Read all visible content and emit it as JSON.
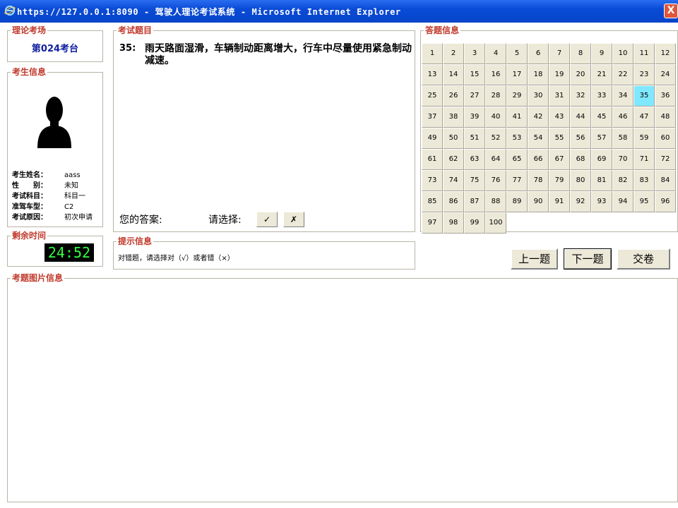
{
  "window": {
    "title": "https://127.0.0.1:8090 - 驾驶人理论考试系统 - Microsoft Internet Explorer",
    "close_label": "X"
  },
  "exam_venue": {
    "legend": "理论考场",
    "seat": "第024考台"
  },
  "candidate": {
    "legend": "考生信息",
    "fields": [
      {
        "label": "考生姓名：",
        "value": "aass"
      },
      {
        "label": "性　　别：",
        "value": "未知"
      },
      {
        "label": "考试科目：",
        "value": "科目一"
      },
      {
        "label": "准驾车型：",
        "value": "C2"
      },
      {
        "label": "考试原因：",
        "value": "初次申请"
      }
    ]
  },
  "time_remaining": {
    "legend": "剩余时间",
    "value": "24:52"
  },
  "question": {
    "legend": "考试题目",
    "number": "35:",
    "text": "雨天路面湿滑，车辆制动距离增大，行车中尽量使用紧急制动减速。",
    "your_answer_label": "您的答案:",
    "select_label": "请选择:",
    "true_label": "✓",
    "false_label": "✗"
  },
  "answer_sheet": {
    "legend": "答题信息",
    "total": 100,
    "current": 35
  },
  "hint": {
    "legend": "提示信息",
    "text": "对错题，请选择对（√）或者错（×）"
  },
  "buttons": {
    "prev": "上一题",
    "next": "下一题",
    "submit": "交卷"
  },
  "image_panel": {
    "legend": "考题图片信息"
  }
}
